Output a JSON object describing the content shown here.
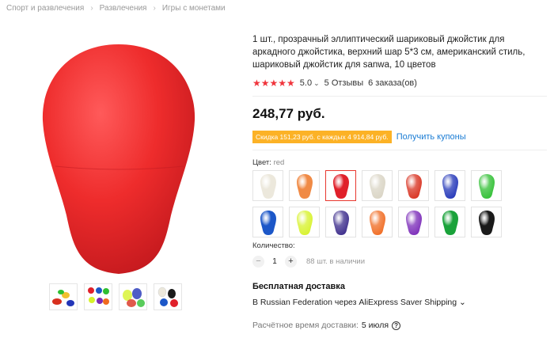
{
  "breadcrumb": {
    "items": [
      "Спорт и развлечения",
      "Развлечения",
      "Игры с монетами"
    ],
    "separator": "›"
  },
  "product": {
    "title": "1 шт., прозрачный эллиптический шариковый джойстик для аркадного джойстика, верхний шар 5*3 см, американский стиль, шариковый джойстик для sanwa, 10 цветов",
    "rating": "5.0",
    "stars": "★★★★★",
    "reviews": "5 Отзывы",
    "orders": "6 заказа(ов)",
    "price": "248,77 руб.",
    "coupon_text": "Скидка 151,23 руб. с каждых 4 914,84 руб.",
    "coupon_link": "Получить купоны",
    "accent_color": "#e8382f"
  },
  "color": {
    "label": "Цвет: ",
    "selected": "red",
    "swatches": [
      {
        "name": "white",
        "fill": "#ece8dc",
        "transparent": false
      },
      {
        "name": "orange",
        "fill": "#f08a45",
        "transparent": false
      },
      {
        "name": "red",
        "fill": "#e0202a",
        "transparent": false
      },
      {
        "name": "clear",
        "fill": "#d9d4c4",
        "transparent": true
      },
      {
        "name": "transparent-red",
        "fill": "#d8301e",
        "transparent": true
      },
      {
        "name": "transparent-blue",
        "fill": "#2235b8",
        "transparent": true
      },
      {
        "name": "transparent-green",
        "fill": "#2fbf32",
        "transparent": true
      },
      {
        "name": "blue",
        "fill": "#1c57c8",
        "transparent": false
      },
      {
        "name": "transparent-yellow",
        "fill": "#d7f22a",
        "transparent": true
      },
      {
        "name": "transparent-purple",
        "fill": "#3a2a8a",
        "transparent": true
      },
      {
        "name": "transparent-orange",
        "fill": "#f06a20",
        "transparent": true
      },
      {
        "name": "violet",
        "fill": "#7a2ab8",
        "transparent": true
      },
      {
        "name": "green",
        "fill": "#1aa23a",
        "transparent": false
      },
      {
        "name": "black",
        "fill": "#1a1a1a",
        "transparent": false
      }
    ]
  },
  "quantity": {
    "label": "Количество:",
    "minus": "−",
    "plus": "+",
    "value": "1",
    "stock": "88 шт. в наличии"
  },
  "shipping": {
    "title": "Бесплатная доставка",
    "destination": "В Russian Federation через AliExpress Saver Shipping ⌄",
    "time_label": "Расчётное время доставки:",
    "time_value": "5 июля",
    "help_icon": "?"
  }
}
